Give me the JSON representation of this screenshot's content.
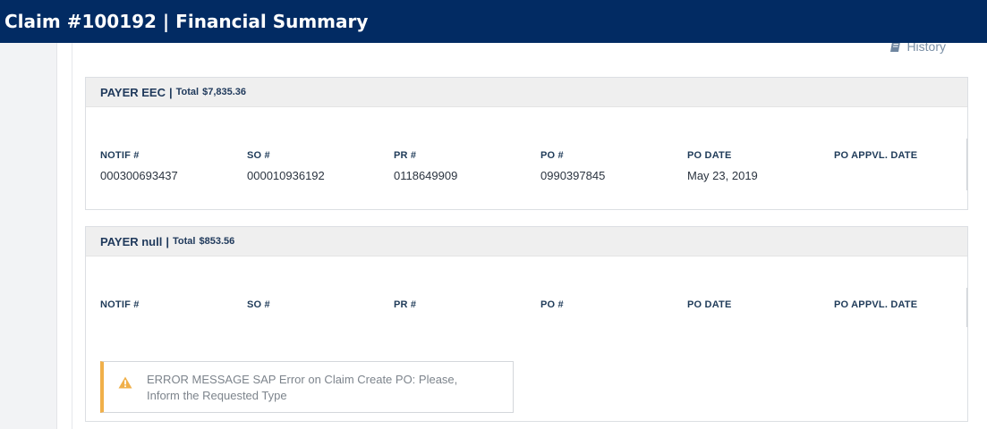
{
  "header": {
    "title": "Claim #100192 | Financial Summary"
  },
  "partial_text": "·[·,·,·,·,·]",
  "history": {
    "label": "History",
    "icon": "book-icon"
  },
  "columns": [
    "NOTIF #",
    "SO #",
    "PR #",
    "PO #",
    "PO DATE",
    "PO APPVL. DATE"
  ],
  "payers": [
    {
      "name": "PAYER EEC",
      "total_label": "Total",
      "total": "$7,835.36",
      "row": [
        "000300693437",
        "000010936192",
        "0118649909",
        "0990397845",
        "May 23, 2019",
        ""
      ]
    },
    {
      "name": "PAYER null",
      "total_label": "Total",
      "total": "$853.56",
      "row": [
        "",
        "",
        "",
        "",
        "",
        ""
      ],
      "error": {
        "icon": "warning-icon",
        "color": "#f0b04a",
        "message": "ERROR MESSAGE SAP Error on Claim Create PO: Please, Inform the Requested Type"
      }
    }
  ],
  "colors": {
    "titlebar": "#022b63",
    "card_header": "#efefef",
    "warning": "#f0b04a",
    "link": "#7a8fa6"
  }
}
